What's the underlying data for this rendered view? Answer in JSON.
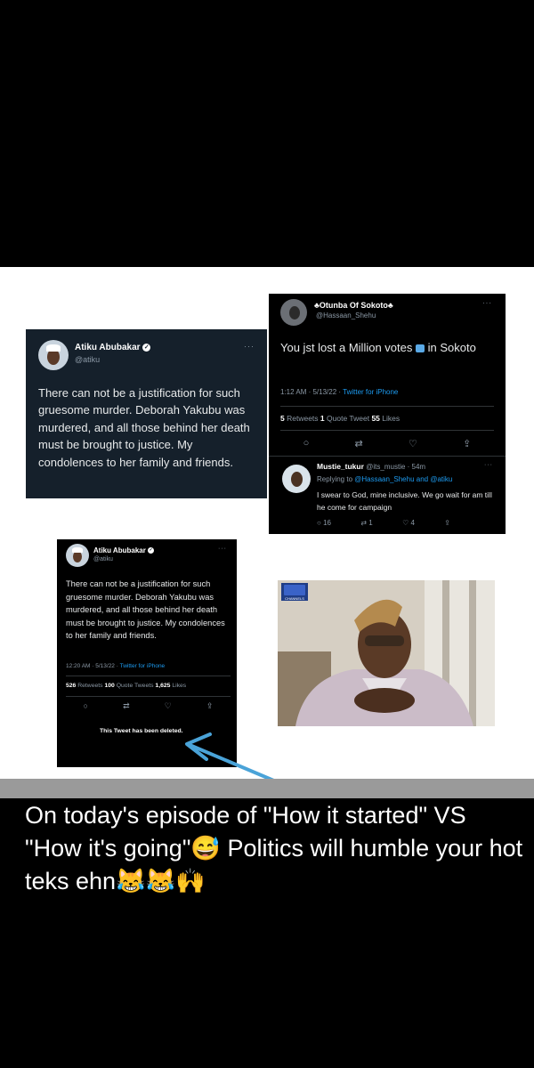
{
  "tweet1": {
    "name": "Atiku Abubakar",
    "handle": "@atiku",
    "more": "···",
    "text": "There can not be a justification for such gruesome murder. Deborah Yakubu was murdered, and all those behind her death must be brought to justice. My condolences to her family and friends."
  },
  "tweet2": {
    "name": "Otunba Of Sokoto",
    "handle": "@Hassaan_Shehu",
    "more": "···",
    "text_before": "You jst lost a Million votes",
    "text_after": "in Sokoto",
    "time": "1:12 AM · 5/13/22 · ",
    "source": "Twitter for iPhone",
    "retweets": "5",
    "retweets_label": "Retweets",
    "quotes": "1",
    "quotes_label": "Quote Tweet",
    "likes": "55",
    "likes_label": "Likes",
    "reply": {
      "name": "Mustie_tukur",
      "handle_time": "@its_mustie · 54m",
      "more": "···",
      "replying_prefix": "Replying to ",
      "replying_to": "@Hassaan_Shehu and @atiku",
      "text": "I swear to God, mine inclusive. We go wait for am till he come for campaign",
      "reply_count": "16",
      "retweet_count": "1",
      "like_count": "4"
    }
  },
  "tweet3": {
    "name": "Atiku Abubakar",
    "handle": "@atiku",
    "more": "···",
    "text": "There can not be a justification for such gruesome murder. Deborah Yakubu was murdered, and all those behind her death must be brought to justice. My condolences to her family and friends.",
    "time": "12:20 AM · 5/13/22 · ",
    "source": "Twitter for iPhone",
    "retweets": "526",
    "retweets_label": "Retweets",
    "quotes": "100",
    "quotes_label": "Quote Tweets",
    "likes": "1,625",
    "likes_label": "Likes",
    "deleted": "This Tweet has been deleted."
  },
  "photo": {
    "logo": "CHANNELS"
  },
  "caption": {
    "line": "On today's episode of \"How it started\" VS \"How it's going\"😅 Politics will humble your hot teks ehn😹😹🙌"
  },
  "colors": {
    "twitter_blue": "#1d9bf0",
    "dim_bg": "#15202b",
    "arrow": "#4aa3d8"
  }
}
